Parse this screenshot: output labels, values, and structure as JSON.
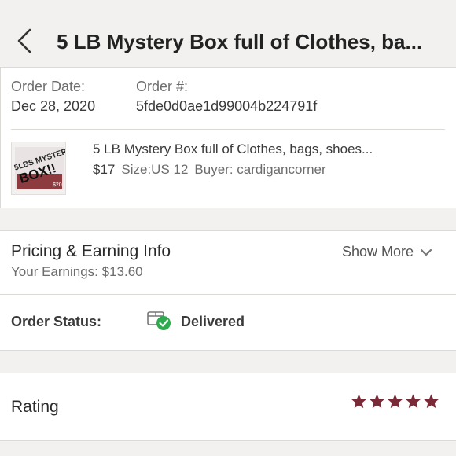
{
  "header": {
    "title": "5 LB Mystery Box full of Clothes, ba..."
  },
  "order": {
    "date_label": "Order Date:",
    "date_value": "Dec 28, 2020",
    "number_label": "Order #:",
    "number_value": "5fde0d0ae1d99004b224791f"
  },
  "item": {
    "title": "5 LB Mystery Box full of Clothes, bags, shoes...",
    "price": "$17",
    "size": "Size:US 12",
    "buyer": "Buyer: cardigancorner",
    "thumb_text_1": "5LBS MYSTERY",
    "thumb_text_2": "BOX!!",
    "thumb_price": "$20"
  },
  "pricing": {
    "title": "Pricing & Earning Info",
    "earnings": "Your Earnings: $13.60",
    "show_more": "Show More"
  },
  "status": {
    "label": "Order Status:",
    "value": "Delivered"
  },
  "rating": {
    "label": "Rating",
    "stars": 5,
    "max_stars": 5
  },
  "colors": {
    "header_bg": "#f2f1ef",
    "star_color": "#7a2a36",
    "delivered_check": "#2eaa4f"
  }
}
